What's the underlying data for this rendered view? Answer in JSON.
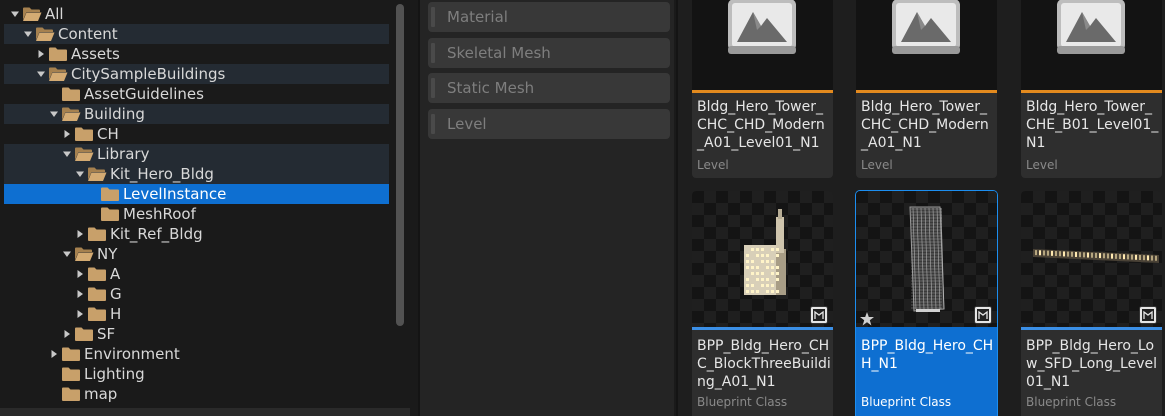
{
  "tree": {
    "items": [
      {
        "label": "All",
        "depth": 0,
        "expanded": true,
        "arrow": "down",
        "open_folder": true,
        "shaded": false,
        "selected": false
      },
      {
        "label": "Content",
        "depth": 1,
        "expanded": true,
        "arrow": "down",
        "open_folder": true,
        "shaded": true,
        "selected": false
      },
      {
        "label": "Assets",
        "depth": 2,
        "arrow": "right",
        "open_folder": false,
        "shaded": false,
        "selected": false
      },
      {
        "label": "CitySampleBuildings",
        "depth": 2,
        "arrow": "down",
        "open_folder": true,
        "shaded": true,
        "selected": false
      },
      {
        "label": "AssetGuidelines",
        "depth": 3,
        "arrow": "none",
        "open_folder": false,
        "shaded": false,
        "selected": false
      },
      {
        "label": "Building",
        "depth": 3,
        "arrow": "down",
        "open_folder": true,
        "shaded": true,
        "selected": false
      },
      {
        "label": "CH",
        "depth": 4,
        "arrow": "right",
        "open_folder": false,
        "shaded": false,
        "selected": false
      },
      {
        "label": "Library",
        "depth": 4,
        "arrow": "down",
        "open_folder": true,
        "shaded": true,
        "selected": false
      },
      {
        "label": "Kit_Hero_Bldg",
        "depth": 5,
        "arrow": "down",
        "open_folder": true,
        "shaded": true,
        "selected": false
      },
      {
        "label": "LevelInstance",
        "depth": 6,
        "arrow": "none",
        "open_folder": false,
        "shaded": false,
        "selected": true
      },
      {
        "label": "MeshRoof",
        "depth": 6,
        "arrow": "none",
        "open_folder": false,
        "shaded": false,
        "selected": false
      },
      {
        "label": "Kit_Ref_Bldg",
        "depth": 5,
        "arrow": "right",
        "open_folder": false,
        "shaded": false,
        "selected": false
      },
      {
        "label": "NY",
        "depth": 4,
        "arrow": "down",
        "open_folder": true,
        "shaded": false,
        "selected": false
      },
      {
        "label": "A",
        "depth": 5,
        "arrow": "right",
        "open_folder": false,
        "shaded": false,
        "selected": false
      },
      {
        "label": "G",
        "depth": 5,
        "arrow": "right",
        "open_folder": false,
        "shaded": false,
        "selected": false
      },
      {
        "label": "H",
        "depth": 5,
        "arrow": "right",
        "open_folder": false,
        "shaded": false,
        "selected": false
      },
      {
        "label": "SF",
        "depth": 4,
        "arrow": "right",
        "open_folder": false,
        "shaded": false,
        "selected": false
      },
      {
        "label": "Environment",
        "depth": 3,
        "arrow": "right",
        "open_folder": false,
        "shaded": false,
        "selected": false
      },
      {
        "label": "Lighting",
        "depth": 3,
        "arrow": "none",
        "open_folder": false,
        "shaded": false,
        "selected": false
      },
      {
        "label": "map",
        "depth": 3,
        "arrow": "none",
        "open_folder": false,
        "shaded": false,
        "selected": false
      }
    ]
  },
  "filters": {
    "items": [
      {
        "label": "Material"
      },
      {
        "label": "Skeletal Mesh"
      },
      {
        "label": "Static Mesh"
      },
      {
        "label": "Level"
      }
    ]
  },
  "assets": {
    "items": [
      {
        "name": "Bldg_Hero_Tower_CHC_CHD_Modern_A01_Level01_N1",
        "type": "Level",
        "thumb": "level-icon",
        "type_color": "#e38a1e",
        "selected": false
      },
      {
        "name": "Bldg_Hero_Tower_CHC_CHD_Modern_A01_N1",
        "type": "Level",
        "thumb": "level-icon",
        "type_color": "#e38a1e",
        "selected": false
      },
      {
        "name": "Bldg_Hero_Tower_CHE_B01_Level01_N1",
        "type": "Level",
        "thumb": "level-icon",
        "type_color": "#e38a1e",
        "selected": false
      },
      {
        "name": "BPP_Bldg_Hero_CHC_BlockThreeBuilding_A01_N1",
        "type": "Blueprint Class",
        "thumb": "building-block-preview",
        "type_color": "#3b8fe6",
        "selected": false
      },
      {
        "name": "BPP_Bldg_Hero_CHH_N1",
        "type": "Blueprint Class",
        "thumb": "tower-preview",
        "type_color": "#3b8fe6",
        "selected": true
      },
      {
        "name": "BPP_Bldg_Hero_Low_SFD_Long_Level01_N1",
        "type": "Blueprint Class",
        "thumb": "long-building-preview",
        "type_color": "#3b8fe6",
        "selected": false
      }
    ]
  }
}
